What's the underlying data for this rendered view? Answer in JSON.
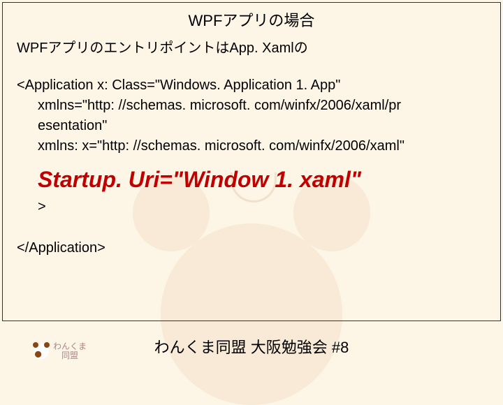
{
  "title": "WPFアプリの場合",
  "line1": "WPFアプリのエントリポイントはApp. Xamlの",
  "code": {
    "open": "<Application x: Class=\"Windows. Application 1. App\"",
    "xmlns1a": "xmlns=\"http: //schemas. microsoft. com/winfx/2006/xaml/pr",
    "xmlns1b": "esentation\"",
    "xmlns2": "xmlns: x=\"http: //schemas. microsoft. com/winfx/2006/xaml\"",
    "startup": "Startup. Uri=\"Window 1. xaml\"",
    "gt": ">",
    "close": "</Application>"
  },
  "logo": {
    "line1": "わんくま",
    "line2": "　同盟"
  },
  "footer": "わんくま同盟 大阪勉強会 #8"
}
